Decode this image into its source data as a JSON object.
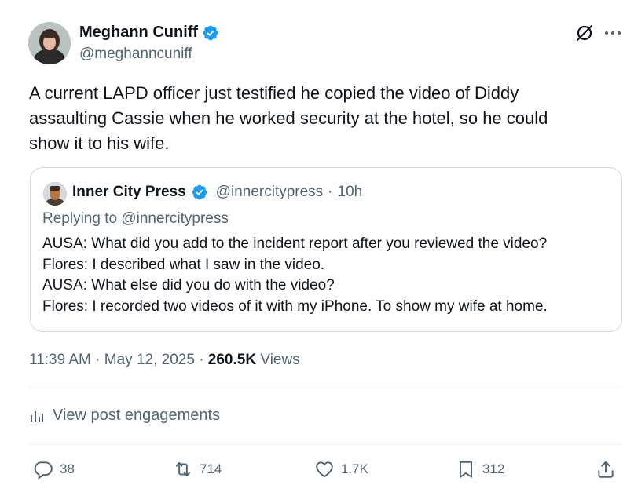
{
  "author": {
    "name": "Meghann Cuniff",
    "handle": "@meghanncuniff",
    "verified_color": "#1d9bf0",
    "avatar_icon": "avatar-photo"
  },
  "tweet": {
    "lines": [
      "A current LAPD officer just testified he copied the video of Diddy",
      "assaulting Cassie when he worked security at the hotel, so he could",
      "show it to his wife."
    ]
  },
  "quote": {
    "name": "Inner City Press",
    "handle": "@innercitypress",
    "separator": "·",
    "time": "10h",
    "replying_to": "Replying to @innercitypress",
    "lines": [
      "AUSA: What did you add to the incident report after you reviewed the video?",
      "Flores: I described what I saw in the video.",
      "AUSA: What else did you do with the video?",
      "Flores: I recorded two videos of it with my iPhone. To show my wife at home."
    ]
  },
  "meta": {
    "time": "11:39 AM",
    "sep1": "·",
    "date": "May 12, 2025",
    "sep2": "·",
    "views_count": "260.5K",
    "views_label": "Views"
  },
  "engagements": {
    "label": "View post engagements",
    "icon": "analytics-icon"
  },
  "actions": {
    "replies": "38",
    "reposts": "714",
    "likes": "1.7K",
    "bookmarks": "312"
  },
  "colors": {
    "text": "#0f1419",
    "secondary": "#536471",
    "border": "#cfd9de",
    "verified": "#1d9bf0"
  }
}
